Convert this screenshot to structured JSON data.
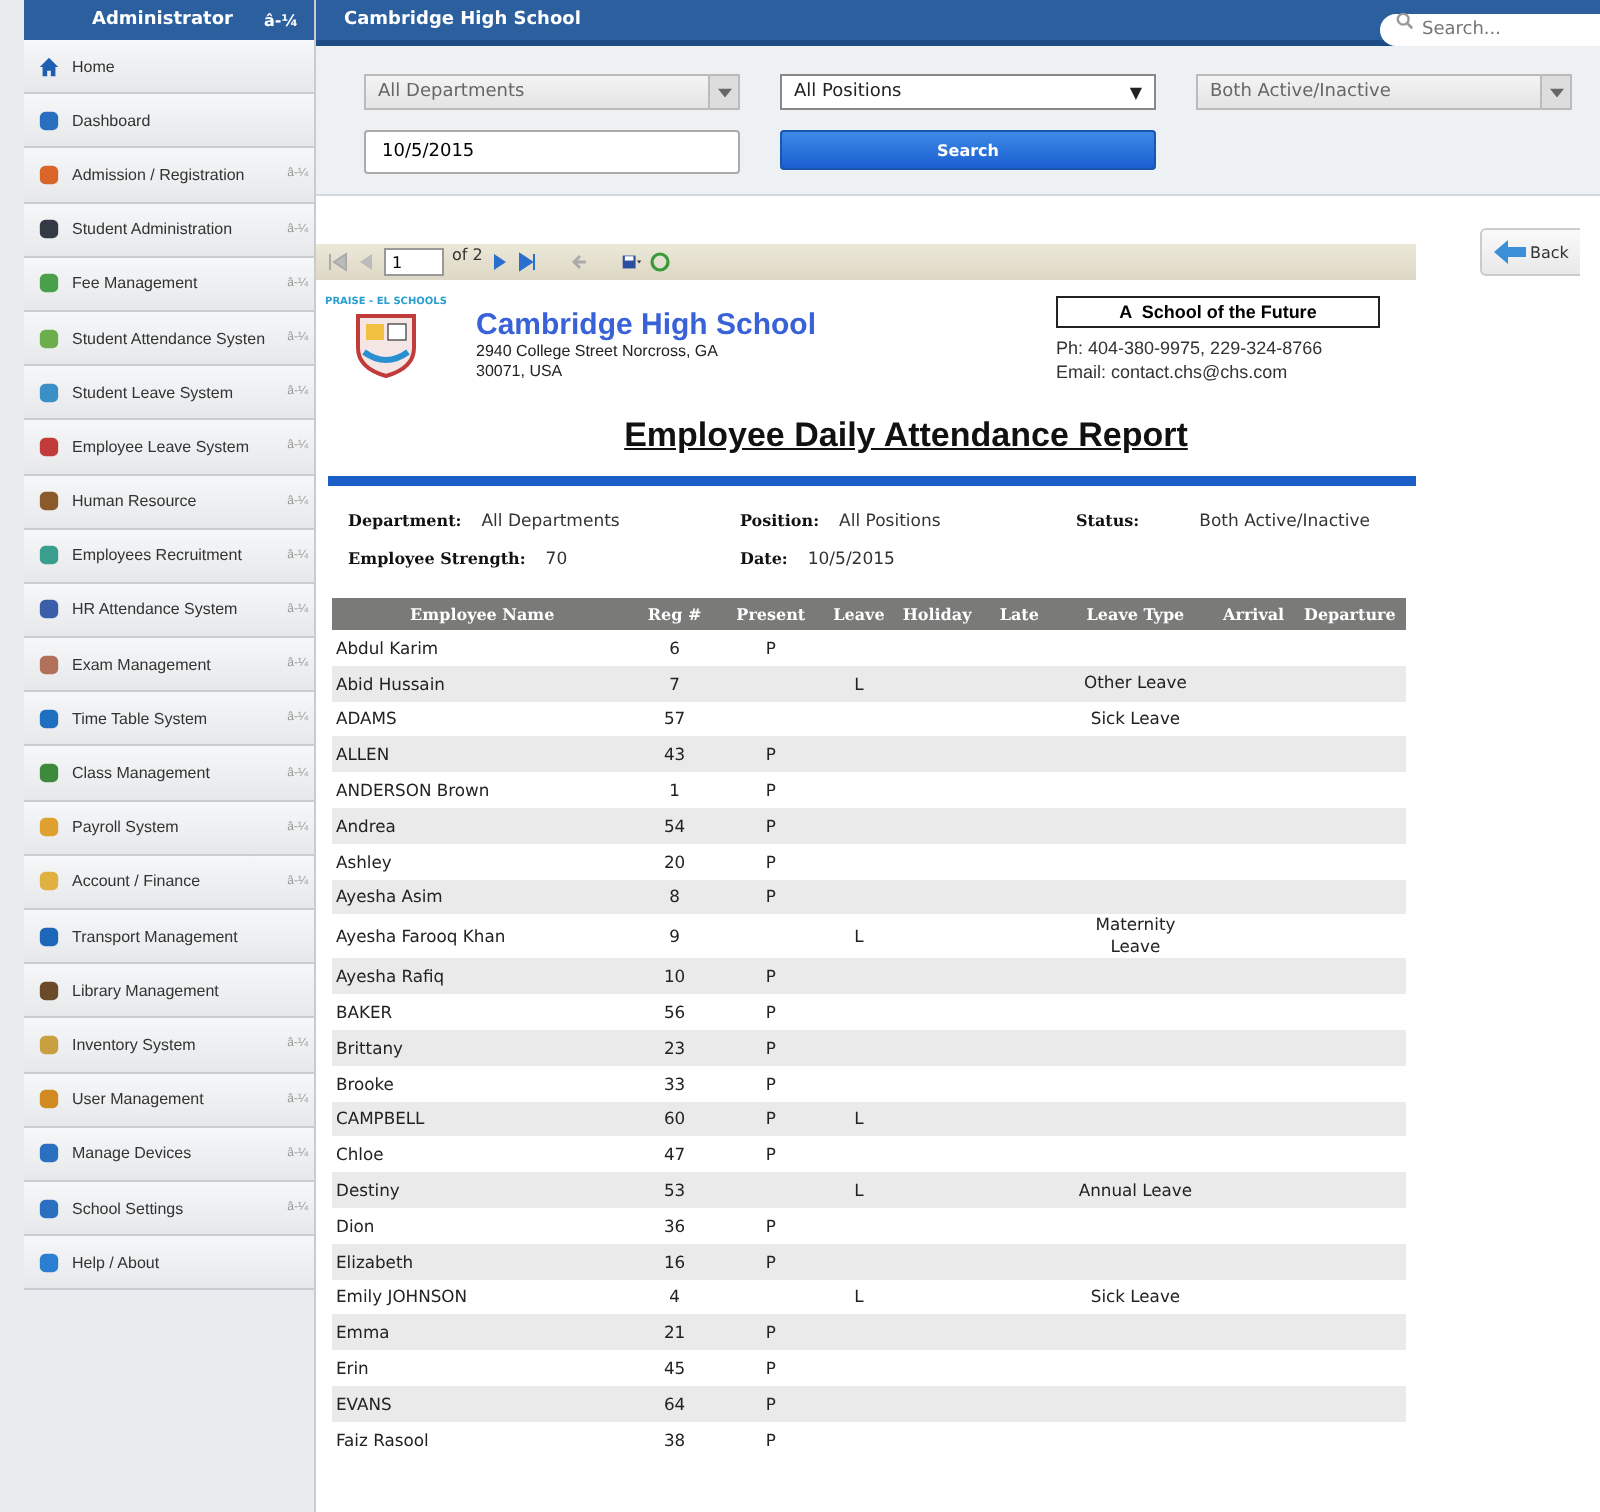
{
  "sidebar": {
    "title": "Administrator",
    "title_caret": "â-¼",
    "items": [
      {
        "label": "Home"
      },
      {
        "label": "Dashboard"
      },
      {
        "label": "Admission / Registration",
        "caret": "â-¼"
      },
      {
        "label": "Student Administration",
        "caret": "â-¼"
      },
      {
        "label": "Fee Management",
        "caret": "â-¼"
      },
      {
        "label": "Student Attendance Systen",
        "caret": "â-¼"
      },
      {
        "label": "Student Leave System",
        "caret": "â-¼"
      },
      {
        "label": "Employee Leave System",
        "caret": "â-¼"
      },
      {
        "label": "Human Resource",
        "caret": "â-¼"
      },
      {
        "label": "Employees Recruitment",
        "caret": "â-¼"
      },
      {
        "label": "HR Attendance System",
        "caret": "â-¼"
      },
      {
        "label": "Exam Management",
        "caret": "â-¼"
      },
      {
        "label": "Time Table System",
        "caret": "â-¼"
      },
      {
        "label": "Class Management",
        "caret": "â-¼"
      },
      {
        "label": "Payroll System",
        "caret": "â-¼"
      },
      {
        "label": "Account / Finance",
        "caret": "â-¼"
      },
      {
        "label": "Transport Management"
      },
      {
        "label": "Library Management"
      },
      {
        "label": "Inventory System",
        "caret": "â-¼"
      },
      {
        "label": "User Management",
        "caret": "â-¼"
      },
      {
        "label": "Manage Devices",
        "caret": "â-¼"
      },
      {
        "label": "School Settings",
        "caret": "â-¼"
      },
      {
        "label": "Help / About"
      }
    ]
  },
  "header": {
    "title": "Cambridge High School",
    "search_placeholder": "Search..."
  },
  "filters": {
    "department": "All Departments",
    "position": "All Positions",
    "position_caret": "▼",
    "status": "Both Active/Inactive",
    "date": "10/5/2015",
    "search_button": "Search"
  },
  "viewer_toolbar": {
    "page": "1",
    "page_count": "of 2",
    "back_button": "Back"
  },
  "report": {
    "school_name": "Cambridge High School",
    "address_lines": [
      "2940 College Street Norcross, GA",
      "30071, USA"
    ],
    "motto": "A  School of the Future",
    "phone": "Ph: 404-380-9975, 229-324-8766",
    "email": "Email: contact.chs@chs.com",
    "logo_text": "PRAISE - EL SCHOOLS",
    "title": "Employee Daily Attendance Report",
    "fields": [
      {
        "label": "Department:",
        "value": "All Departments"
      },
      {
        "label": "Position:",
        "value": "All Positions"
      },
      {
        "label": "Status:",
        "value": "Both Active/Inactive"
      },
      {
        "label": "Employee Strength:",
        "value": "70"
      },
      {
        "label": "Date:",
        "value": "10/5/2015"
      }
    ],
    "table": {
      "columns": [
        "Employee Name",
        "Reg #",
        "Present",
        "Leave",
        "Holiday",
        "Late",
        "Leave Type",
        "Arrival",
        "Departure"
      ],
      "rows": [
        {
          "name": "Abdul Karim",
          "reg": "6",
          "present": "P"
        },
        {
          "name": "Abid Hussain",
          "reg": "7",
          "leave": "L",
          "leave_type": "Other Leave"
        },
        {
          "name": "ADAMS",
          "reg": "57",
          "leave_type": "Sick Leave"
        },
        {
          "name": "ALLEN",
          "reg": "43",
          "present": "P"
        },
        {
          "name": "ANDERSON Brown",
          "reg": "1",
          "present": "P"
        },
        {
          "name": "Andrea",
          "reg": "54",
          "present": "P"
        },
        {
          "name": "Ashley",
          "reg": "20",
          "present": "P"
        },
        {
          "name": "Ayesha Asim",
          "reg": "8",
          "present": "P"
        },
        {
          "name": "Ayesha Farooq Khan",
          "reg": "9",
          "leave": "L",
          "leave_type": "Maternity Leave"
        },
        {
          "name": "Ayesha Rafiq",
          "reg": "10",
          "present": "P"
        },
        {
          "name": "BAKER",
          "reg": "56",
          "present": "P"
        },
        {
          "name": "Brittany",
          "reg": "23",
          "present": "P"
        },
        {
          "name": "Brooke",
          "reg": "33",
          "present": "P"
        },
        {
          "name": "CAMPBELL",
          "reg": "60",
          "present": "P",
          "leave": "L"
        },
        {
          "name": "Chloe",
          "reg": "47",
          "present": "P"
        },
        {
          "name": "Destiny",
          "reg": "53",
          "leave": "L",
          "leave_type": "Annual Leave"
        },
        {
          "name": "Dion",
          "reg": "36",
          "present": "P"
        },
        {
          "name": "Elizabeth",
          "reg": "16",
          "present": "P"
        },
        {
          "name": "Emily JOHNSON",
          "reg": "4",
          "leave": "L",
          "leave_type": "Sick Leave"
        },
        {
          "name": "Emma",
          "reg": "21",
          "present": "P"
        },
        {
          "name": "Erin",
          "reg": "45",
          "present": "P"
        },
        {
          "name": "EVANS",
          "reg": "64",
          "present": "P"
        },
        {
          "name": "Faiz Rasool",
          "reg": "38",
          "present": "P"
        }
      ]
    }
  }
}
